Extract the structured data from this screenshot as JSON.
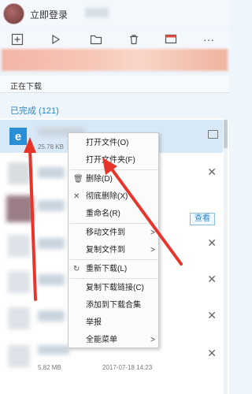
{
  "header": {
    "login_label": "立即登录"
  },
  "tabs": {
    "downloading": "正在下载",
    "completed": "已完成 (121)"
  },
  "files": {
    "first_icon_letter": "e",
    "first_size": "25.78 KB",
    "last_size": "5.82 MB",
    "last_date": "2017-07-18 14:23"
  },
  "buttons": {
    "view": "查看"
  },
  "context_menu": [
    {
      "label": "打开文件(O)",
      "submenu": false,
      "icon": ""
    },
    {
      "label": "打开文件夹(F)",
      "submenu": false,
      "icon": ""
    },
    {
      "label": "删除(D)",
      "submenu": false,
      "icon": "trash-icon"
    },
    {
      "label": "彻底删除(X)",
      "submenu": false,
      "icon": "x-icon"
    },
    {
      "label": "重命名(R)",
      "submenu": false,
      "icon": ""
    },
    {
      "label": "移动文件到",
      "submenu": true,
      "icon": ""
    },
    {
      "label": "复制文件到",
      "submenu": true,
      "icon": ""
    },
    {
      "label": "重新下载(L)",
      "submenu": false,
      "icon": "redo-icon"
    },
    {
      "label": "复制下载链接(C)",
      "submenu": false,
      "icon": ""
    },
    {
      "label": "添加到下载合集",
      "submenu": false,
      "icon": ""
    },
    {
      "label": "举报",
      "submenu": false,
      "icon": ""
    },
    {
      "label": "全能菜单",
      "submenu": true,
      "icon": ""
    }
  ],
  "colors": {
    "accent": "#2a88c9",
    "annotation_arrow": "#e8352c",
    "selected_row": "#d7e8f6"
  }
}
